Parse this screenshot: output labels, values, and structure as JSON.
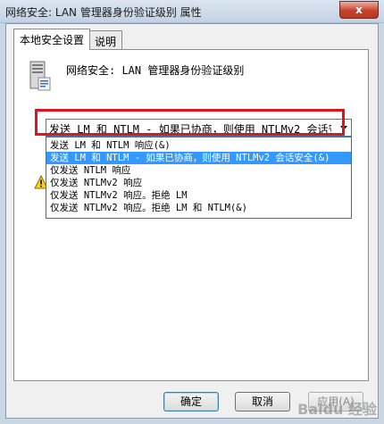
{
  "window": {
    "title": "网络安全: LAN 管理器身份验证级别 属性",
    "close_glyph": "x"
  },
  "tabs": [
    {
      "label": "本地安全设置",
      "active": true
    },
    {
      "label": "说明",
      "active": false
    }
  ],
  "policy": {
    "icon": "server-computer-icon",
    "title": "网络安全: LAN 管理器身份验证级别"
  },
  "combo": {
    "selected_value": "发送 LM 和 NTLM - 如果已协商，则使用 NTLMv2 会话安全"
  },
  "dropdown": {
    "items": [
      {
        "label": "发送 LM 和 NTLM 响应(&)",
        "selected": false
      },
      {
        "label": "发送 LM 和 NTLM - 如果已协商，则使用 NTLMv2 会话安全(&)",
        "selected": true
      },
      {
        "label": "仅发送 NTLM 响应",
        "selected": false
      },
      {
        "label": "仅发送 NTLMv2 响应",
        "selected": false
      },
      {
        "label": "仅发送 NTLMv2 响应。拒绝 LM",
        "selected": false
      },
      {
        "label": "仅发送 NTLMv2 响应。拒绝 LM 和 NTLM(&)",
        "selected": false
      }
    ]
  },
  "buttons": {
    "ok": "确定",
    "cancel": "取消",
    "apply": "应用(A)"
  },
  "watermark": "Baidu 经验",
  "colors": {
    "selection": "#3399ff",
    "highlight_box": "#e0141b"
  }
}
